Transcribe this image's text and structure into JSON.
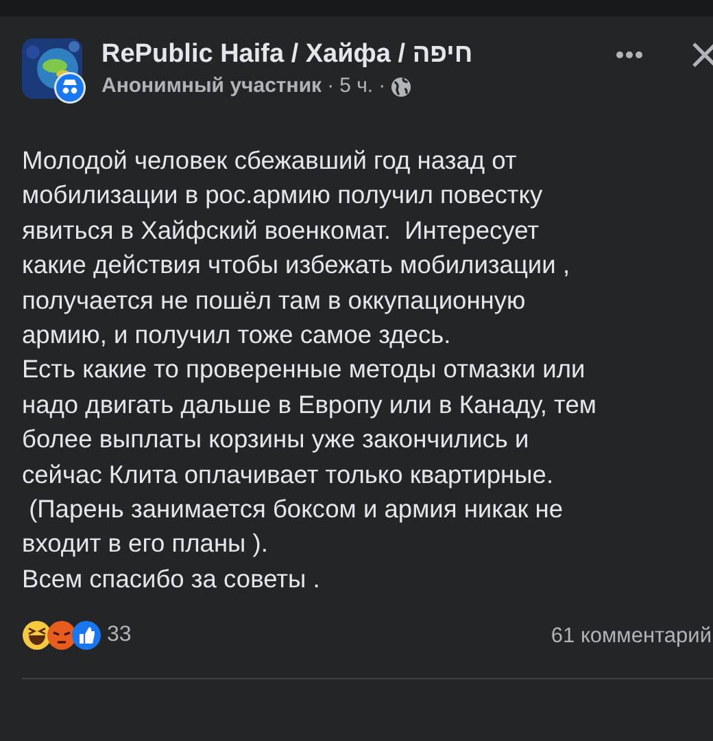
{
  "post": {
    "group": "RePublic Haifa / Хайфа / חיפה",
    "author": "Анонимный участник",
    "time": "5 ч.",
    "separator": "·",
    "lines": [
      "Молодой человек сбежавший год назад от",
      "мобилизации в рос.армию получил повестку",
      "явиться в Хайфский военкомат.  Интересует",
      "какие действия чтобы избежать мобилизации ,",
      "получается не пошёл там в оккупационную",
      "армию, и получил тоже самое здесь.",
      "Есть какие то проверенные методы отмазки или",
      "надо двигать дальше в Европу или в Канаду, тем",
      "более выплаты корзины уже закончились и",
      "сейчас Клита оплачивает только квартирные.",
      " (Парень занимается боксом и армия никак не",
      "входит в его планы ).",
      "Всем спасибо за советы ."
    ],
    "reactions": [
      {
        "kind": "haha"
      },
      {
        "kind": "angry"
      },
      {
        "kind": "like"
      }
    ],
    "reaction_count": "33",
    "comments": "61 комментарий"
  }
}
